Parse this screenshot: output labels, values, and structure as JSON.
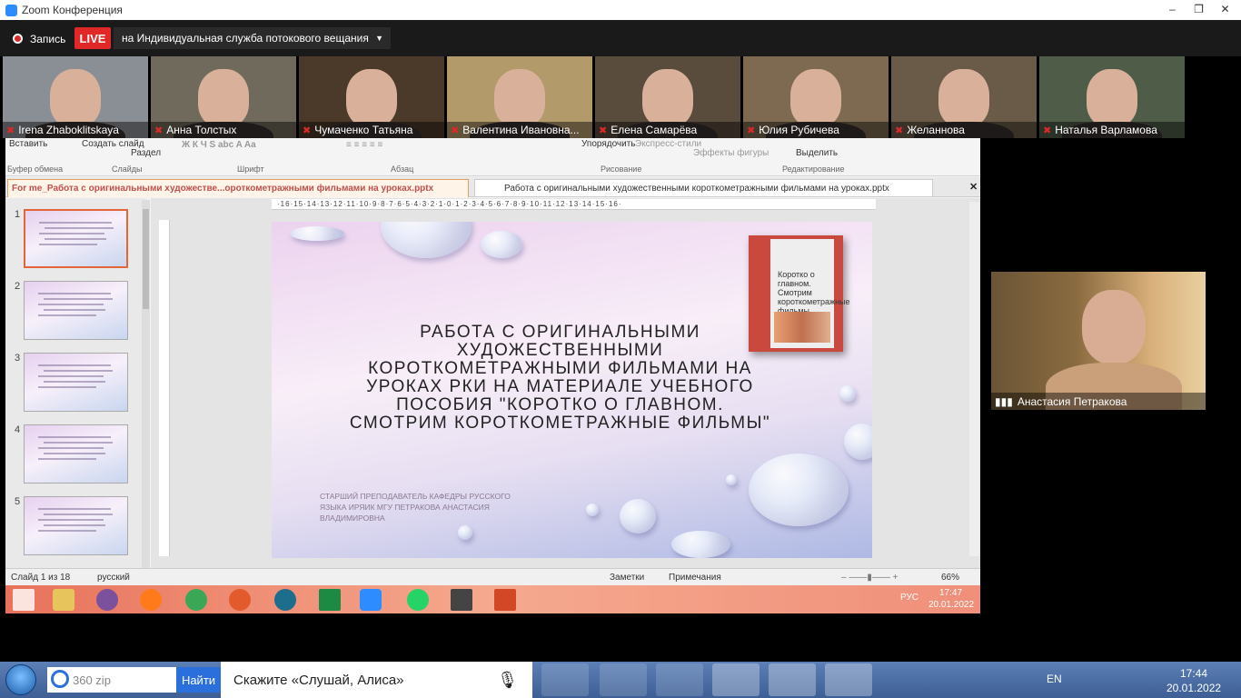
{
  "zoom": {
    "title": "Zoom Конференция",
    "rec_label": "Запись",
    "live": "LIVE",
    "stream_label": "на Индивидуальная служба потокового вещания"
  },
  "participants": [
    {
      "name": "Irena Zhaboklitskaya",
      "bg": "#8a8f96"
    },
    {
      "name": "Анна Толстых",
      "bg": "#6f6a5c"
    },
    {
      "name": "Чумаченко Татьяна",
      "bg": "#4b3a2a"
    },
    {
      "name": "Валентина Ивановна...",
      "bg": "#b29a6a"
    },
    {
      "name": "Елена Самарёва",
      "bg": "#5a4c3d"
    },
    {
      "name": "Юлия Рубичева",
      "bg": "#7d6a50"
    },
    {
      "name": "Желаннова",
      "bg": "#6a5a48"
    },
    {
      "name": "Наталья Варламова",
      "bg": "#4e5c48"
    }
  ],
  "speaker": {
    "name": "Анастасия Петракова"
  },
  "ppt": {
    "ribbon": {
      "paste": "Вставить",
      "clipboard": "Буфер обмена",
      "create_slide": "Создать слайд",
      "section": "Раздел",
      "slides": "Слайды",
      "font": "Шрифт",
      "paragraph": "Абзац",
      "arrange": "Упорядочить",
      "express_styles": "Экспресс-стили",
      "shape_effects": "Эффекты фигуры",
      "drawing": "Рисование",
      "select": "Выделить",
      "editing": "Редактирование"
    },
    "tab_active": "For me_Работа с оригинальными художестве...ороткометражными фильмами на уроках.pptx",
    "tab_second": "Работа с оригинальными художественными короткометражными фильмами на уроках.pptx",
    "thumb_numbers": [
      "1",
      "2",
      "3",
      "4",
      "5"
    ],
    "ruler": "·16·15·14·13·12·11·10·9·8·7·6·5·4·3·2·1·0·1·2·3·4·5·6·7·8·9·10·11·12·13·14·15·16·",
    "slide": {
      "title": "Работа с оригинальными художественными короткометражными фильмами на уроках РКИ на материале учебного пособия \"Коротко о главном. Смотрим короткометражные фильмы\"",
      "subtitle": "Старший преподаватель кафедры русского языка ИРЯиК МГУ Петракова Анастасия Владимировна",
      "book_title": "Коротко о главном. Смотрим короткометражные фильмы"
    },
    "status": {
      "slide_of": "Слайд 1 из 18",
      "lang": "русский",
      "notes": "Заметки",
      "comments": "Примечания",
      "zoom": "66%"
    },
    "inner_clock": {
      "time": "17:47",
      "date": "20.01.2022",
      "lang": "РУС"
    }
  },
  "taskbar": {
    "search_value": "360 zip",
    "search_button": "Найти",
    "alice": "Скажите «Слушай, Алиса»",
    "lang": "EN",
    "time": "17:44",
    "date": "20.01.2022"
  }
}
